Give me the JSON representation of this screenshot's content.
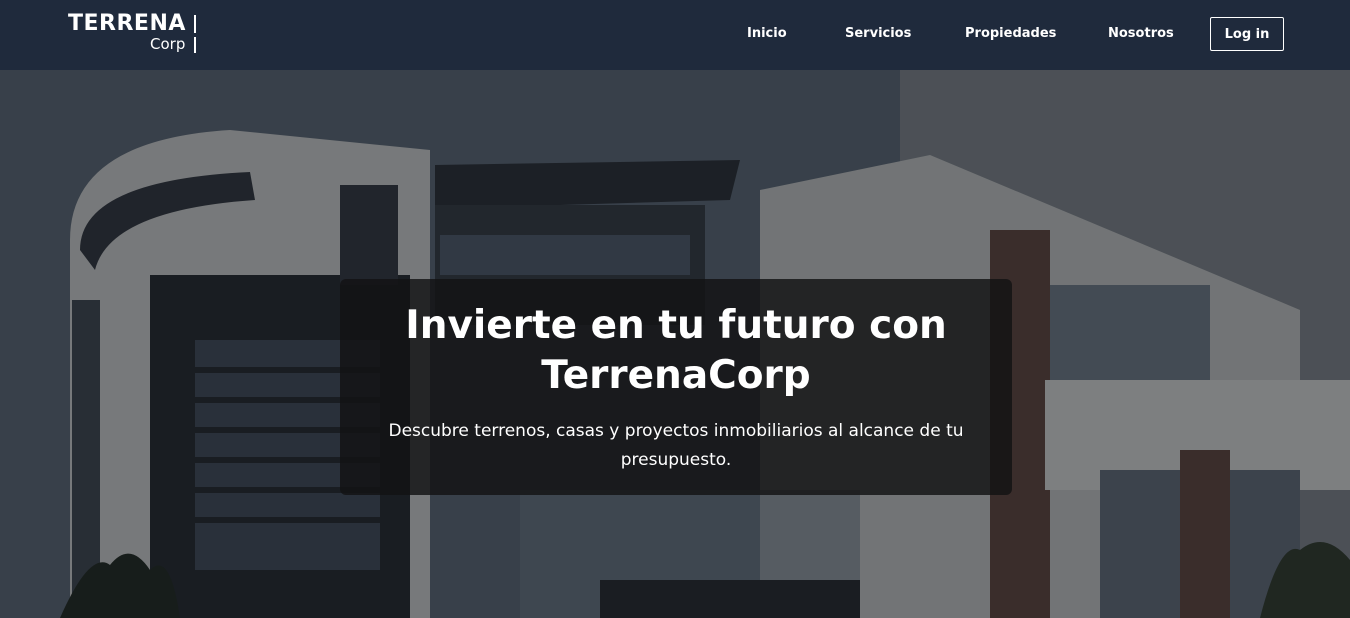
{
  "brand": {
    "name_top": "TERRENA",
    "name_bottom": "Corp"
  },
  "nav": {
    "items": [
      {
        "label": "Inicio"
      },
      {
        "label": "Servicios"
      },
      {
        "label": "Propiedades"
      },
      {
        "label": "Nosotros"
      }
    ],
    "login_label": "Log in"
  },
  "hero": {
    "title": "Invierte en tu futuro con TerrenaCorp",
    "subtitle": "Descubre terrenos, casas y proyectos inmobiliarios al alcance de tu presupuesto.",
    "background_image": "modern-house-photo"
  },
  "colors": {
    "header_bg": "#1f2a3c",
    "text": "#ffffff",
    "card_bg": "#121214"
  }
}
